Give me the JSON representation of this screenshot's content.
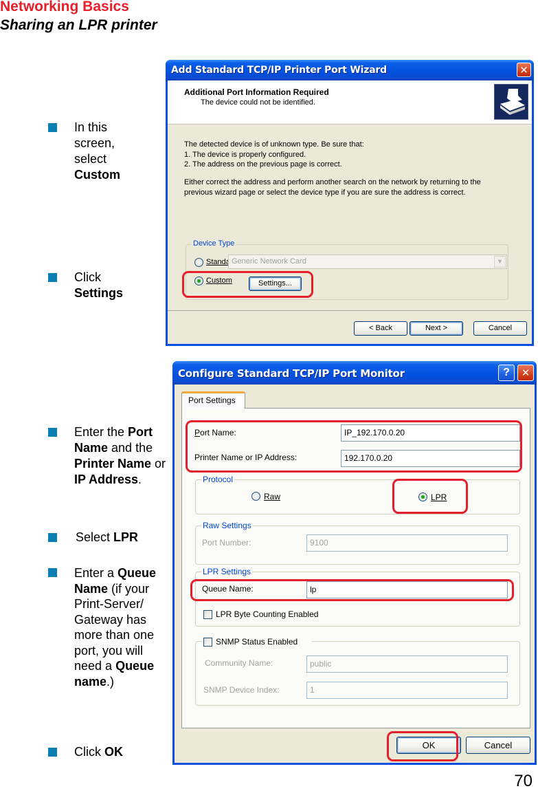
{
  "header": {
    "title": "Networking Basics",
    "subtitle": "Sharing an LPR printer"
  },
  "colors": {
    "header_red": "#e8202a",
    "bullet_blue": "#0a7fb4",
    "highlight_red": "#e5202d",
    "xp_title_blue": "#0450df",
    "xp_face": "#ece9d8"
  },
  "instructions": [
    {
      "pre": "In this screen, select ",
      "bold": "Custom",
      "post": ""
    },
    {
      "pre": "Click ",
      "bold": "Settings",
      "post": ""
    },
    {
      "pre": "Enter the ",
      "bold": "Port Name",
      "mid": " and the ",
      "bold2": "Printer Name",
      "mid2": " or ",
      "bold3": "IP Address",
      "post": "."
    },
    {
      "pre": "Select ",
      "bold": "LPR",
      "post": ""
    },
    {
      "pre": "Enter a ",
      "bold": "Queue Name",
      "mid": " (if your Print-Server/ Gateway has more than one port, you will need a ",
      "bold2": "Queue name",
      "post": ".)"
    },
    {
      "pre": "Click ",
      "bold": "OK",
      "post": ""
    }
  ],
  "wizard": {
    "title": "Add Standard TCP/IP Printer Port Wizard",
    "close_icon": "close-icon",
    "heading": "Additional Port Information Required",
    "subheading": "The device could not be identified.",
    "body_lines": [
      "The detected device is of unknown type.  Be sure that:",
      "1. The device is properly configured.",
      "2.  The address on the previous page is correct."
    ],
    "body_para": [
      "Either correct the address and perform another search on the network by returning to the",
      "previous wizard page or select the device type if you are sure the address is correct."
    ],
    "device_type": {
      "legend": "Device Type",
      "standard_label": "Standard",
      "standard_checked": false,
      "standard_dropdown_value": "Generic Network Card",
      "custom_label": "Custom",
      "custom_checked": true,
      "settings_button": "Settings..."
    },
    "buttons": {
      "back": "< Back",
      "next": "Next >",
      "cancel": "Cancel"
    }
  },
  "port_monitor": {
    "title": "Configure Standard TCP/IP Port Monitor",
    "help_icon": "?",
    "close_icon": "close-icon",
    "tab": "Port Settings",
    "port_name_label": "Port Name:",
    "port_name_value": "IP_192.170.0.20",
    "printer_name_label": "Printer Name or IP Address:",
    "printer_name_value": "192.170.0.20",
    "protocol": {
      "legend": "Protocol",
      "raw_label": "Raw",
      "raw_checked": false,
      "lpr_label": "LPR",
      "lpr_checked": true
    },
    "raw_settings": {
      "legend": "Raw Settings",
      "port_number_label": "Port Number:",
      "port_number_value": "9100"
    },
    "lpr_settings": {
      "legend": "LPR Settings",
      "queue_name_label": "Queue Name:",
      "queue_name_value": "lp",
      "byte_counting_label": "LPR Byte Counting Enabled",
      "byte_counting_checked": false
    },
    "snmp": {
      "label": "SNMP Status Enabled",
      "checked": false,
      "community_label": "Community Name:",
      "community_value": "public",
      "device_index_label": "SNMP Device Index:",
      "device_index_value": "1"
    },
    "buttons": {
      "ok": "OK",
      "cancel": "Cancel"
    }
  },
  "page_number": "70"
}
